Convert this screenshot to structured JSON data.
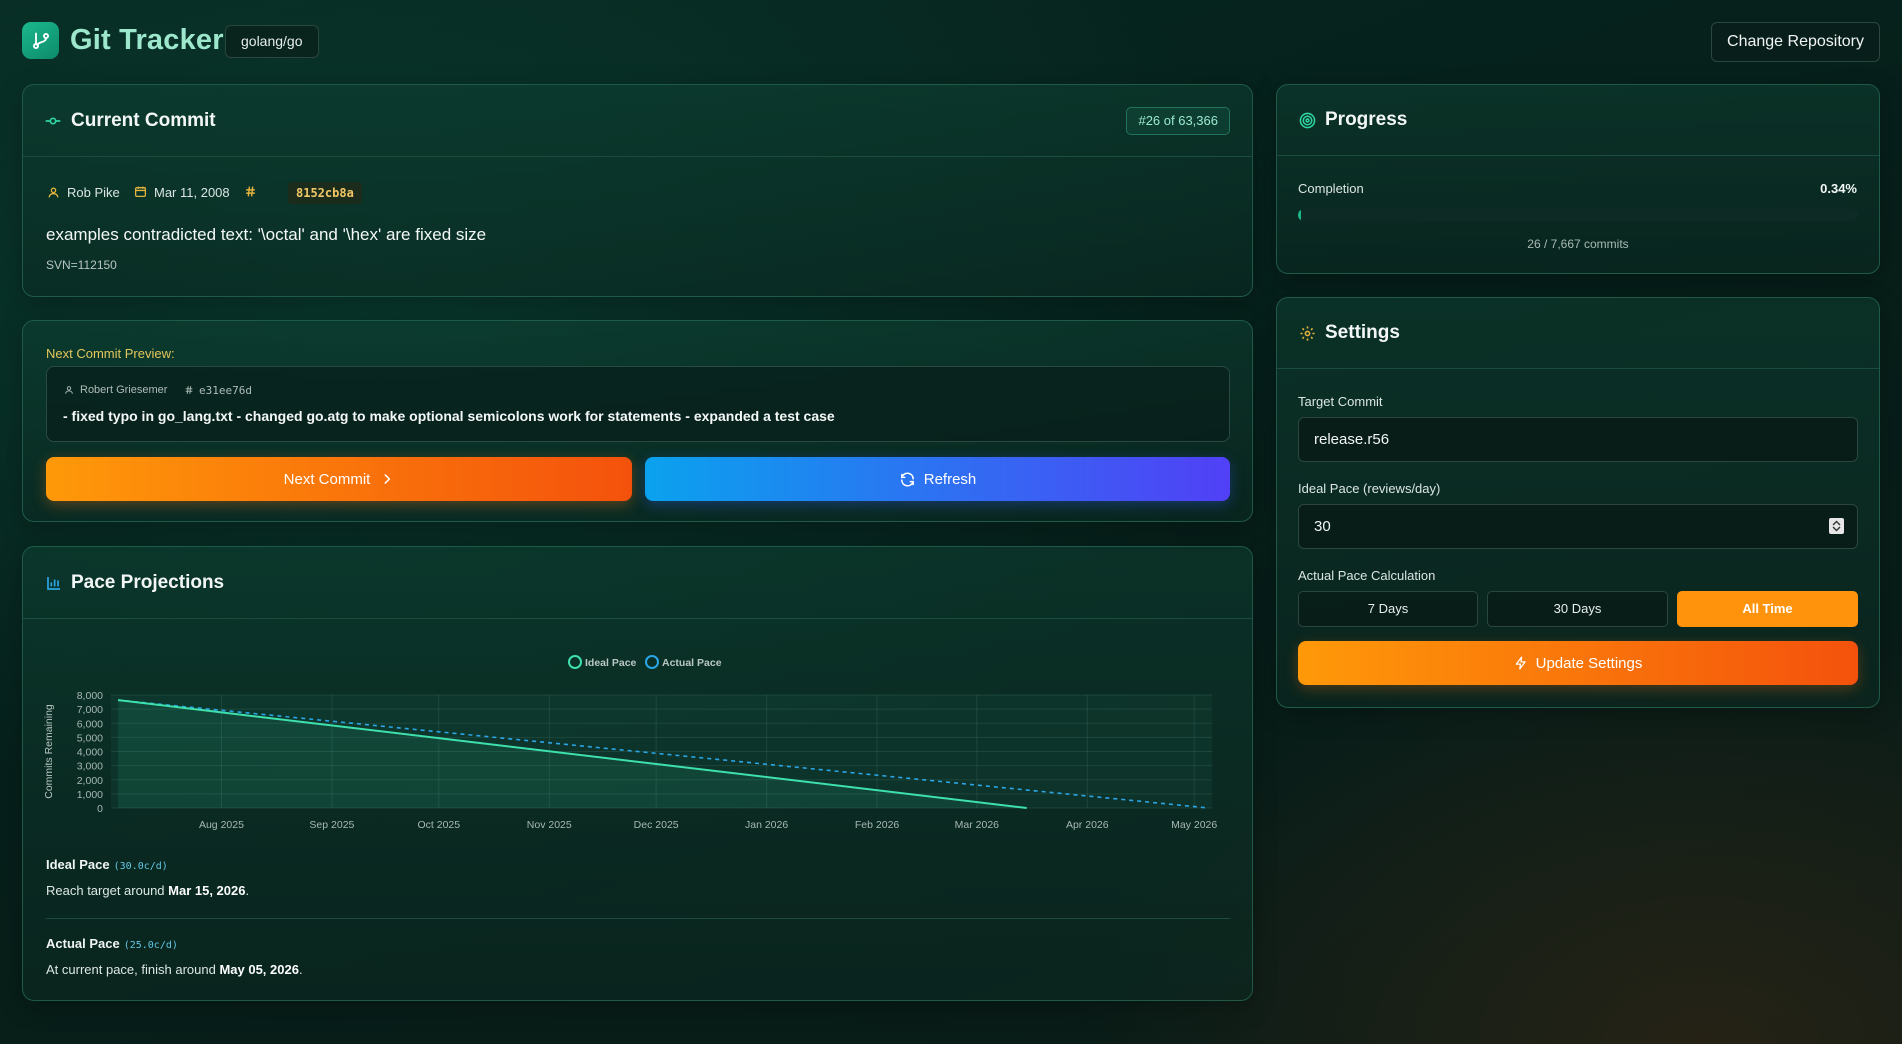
{
  "app": {
    "title": "Git Tracker",
    "repo": "golang/go",
    "change_repo_label": "Change Repository"
  },
  "current": {
    "title": "Current Commit",
    "badge": "#26 of 63,366",
    "author": "Rob Pike",
    "date": "Mar 11, 2008",
    "hash": "8152cb8a",
    "message": "examples contradicted text: '\\octal' and '\\hex' are fixed size",
    "sub": "SVN=112150"
  },
  "next": {
    "label": "Next Commit Preview:",
    "author": "Robert Griesemer",
    "hash": "e31ee76d",
    "message": "- fixed typo in go_lang.txt - changed go.atg to make optional semicolons work for statements - expanded a test case",
    "next_button": "Next Commit",
    "refresh_button": "Refresh"
  },
  "pace": {
    "title": "Pace Projections",
    "ideal_label": "Ideal Pace",
    "ideal_rate": "(30.0c/d)",
    "ideal_text_pre": "Reach target around ",
    "ideal_date": "Mar 15, 2026",
    "actual_label": "Actual Pace",
    "actual_rate": "(25.0c/d)",
    "actual_text_pre": "At current pace, finish around ",
    "actual_date": "May 05, 2026"
  },
  "chart_data": {
    "type": "line",
    "ylabel": "Commits Remaining",
    "xlabel": "",
    "ylim": [
      0,
      8000
    ],
    "yticks": [
      "8,000",
      "7,000",
      "6,000",
      "5,000",
      "4,000",
      "3,000",
      "2,000",
      "1,000",
      "0"
    ],
    "xticks": [
      "Aug 2025",
      "Sep 2025",
      "Oct 2025",
      "Nov 2025",
      "Dec 2025",
      "Jan 2026",
      "Feb 2026",
      "Mar 2026",
      "Apr 2026",
      "May 2026"
    ],
    "legend": [
      "Ideal Pace",
      "Actual Pace"
    ],
    "series": [
      {
        "name": "Ideal Pace",
        "color": "#3ee0ac",
        "style": "solid",
        "start": {
          "x": "2025-07-03",
          "y": 7641
        },
        "end": {
          "x": "2026-03-15",
          "y": 0
        }
      },
      {
        "name": "Actual Pace",
        "color": "#2aa6e6",
        "style": "dashed",
        "start": {
          "x": "2025-07-03",
          "y": 7641
        },
        "end": {
          "x": "2026-05-05",
          "y": 0
        }
      }
    ],
    "grid": true,
    "legend_position": "top-center"
  },
  "progress": {
    "title": "Progress",
    "completion_label": "Completion",
    "percent_text": "0.34%",
    "percent_value": 0.34,
    "count_text": "26 / 7,667 commits"
  },
  "settings": {
    "title": "Settings",
    "target_label": "Target Commit",
    "target_value": "release.r56",
    "pace_label": "Ideal Pace (reviews/day)",
    "pace_value": "30",
    "calc_label": "Actual Pace Calculation",
    "options": [
      "7 Days",
      "30 Days",
      "All Time"
    ],
    "selected": "All Time",
    "update_button": "Update Settings"
  },
  "colors": {
    "accent": "#19b889",
    "orange": "#ff930b",
    "blue": "#2aa6e6",
    "gold": "#e4c65a"
  }
}
